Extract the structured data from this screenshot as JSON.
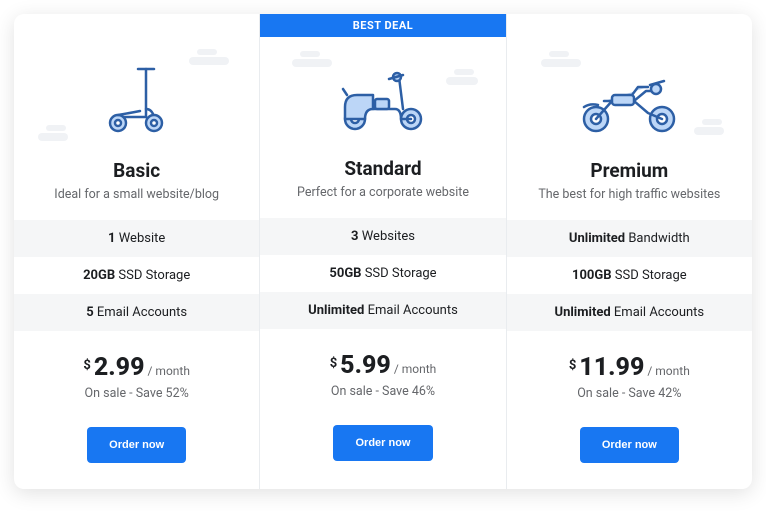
{
  "badge_label": "BEST DEAL",
  "currency_symbol": "$",
  "period_label": "/ month",
  "cta_label": "Order now",
  "plans": [
    {
      "id": "basic",
      "title": "Basic",
      "subtitle": "Ideal for a small website/blog",
      "featured": false,
      "icon": "scooter-icon",
      "features": [
        {
          "bold": "1",
          "rest": " Website"
        },
        {
          "bold": "20GB",
          "rest": " SSD Storage"
        },
        {
          "bold": "5",
          "rest": " Email Accounts"
        }
      ],
      "price": "2.99",
      "sale_text": "On sale - Save 52%"
    },
    {
      "id": "standard",
      "title": "Standard",
      "subtitle": "Perfect for a corporate website",
      "featured": true,
      "icon": "moped-icon",
      "features": [
        {
          "bold": "3",
          "rest": " Websites"
        },
        {
          "bold": "50GB",
          "rest": " SSD Storage"
        },
        {
          "bold": "Unlimited",
          "rest": " Email Accounts"
        }
      ],
      "price": "5.99",
      "sale_text": "On sale - Save 46%"
    },
    {
      "id": "premium",
      "title": "Premium",
      "subtitle": "The best for high traffic websites",
      "featured": false,
      "icon": "motorcycle-icon",
      "features": [
        {
          "bold": "Unlimited",
          "rest": " Bandwidth"
        },
        {
          "bold": "100GB",
          "rest": " SSD Storage"
        },
        {
          "bold": "Unlimited",
          "rest": " Email Accounts"
        }
      ],
      "price": "11.99",
      "sale_text": "On sale - Save 42%"
    }
  ],
  "colors": {
    "accent": "#1877f2",
    "icon_fill": "#bcd6f7",
    "icon_stroke": "#2d5fa5"
  }
}
